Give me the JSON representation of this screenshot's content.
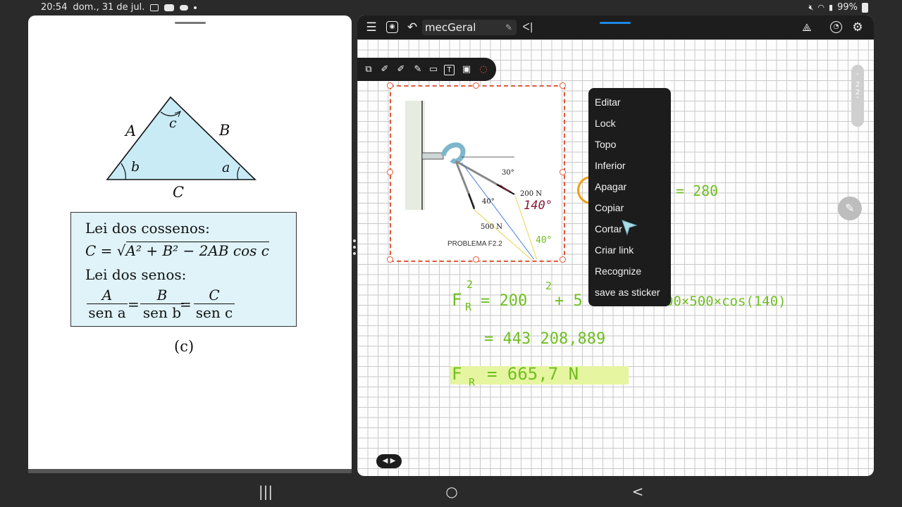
{
  "status_bar": {
    "time": "20:54",
    "date": "dom., 31 de jul.",
    "battery": "99%",
    "icons_left": [
      "screen-record-icon",
      "youtube-icon",
      "cloud-icon",
      "dot-icon"
    ],
    "icons_right": [
      "mute-icon",
      "wifi-icon",
      "signal-icon",
      "battery-icon"
    ]
  },
  "left_pane": {
    "triangle": {
      "side_A": "A",
      "side_B": "B",
      "side_C": "C",
      "angle_a": "a",
      "angle_b": "b",
      "angle_c": "c",
      "fill": "#c8ebf6"
    },
    "formulas": {
      "cosine_title": "Lei dos cossenos:",
      "cosine_lhs": "C =",
      "cosine_rhs": "A² + B² − 2AB cos c",
      "sine_title": "Lei dos senos:",
      "sine_terms": [
        {
          "num": "A",
          "den": "sen a"
        },
        {
          "num": "B",
          "den": "sen b"
        },
        {
          "num": "C",
          "den": "sen c"
        }
      ],
      "equals": "="
    },
    "caption": "(c)"
  },
  "right_pane": {
    "toolbar": {
      "title": "mecGeral",
      "icons": [
        "menu-icon",
        "view-icon",
        "undo-icon",
        "edit-title-icon",
        "collapse-icon",
        "ai-icon",
        "history-icon",
        "settings-icon"
      ]
    },
    "pen_tools": [
      "select-icon",
      "pen-icon",
      "pen-icon",
      "highlighter-icon",
      "eraser-icon",
      "text-icon",
      "image-icon",
      "lasso-icon"
    ],
    "page_indicator": {
      "current": "2",
      "total": "2"
    },
    "figure": {
      "label_30": "30°",
      "label_40": "40°",
      "label_200": "200 N",
      "label_500": "500 N",
      "label_problem": "PROBLEMA F2.2"
    },
    "ink": {
      "angle_140": "140°",
      "angle_40": "40°",
      "eq_280": "= 280",
      "line1_lhs": "F",
      "line1_sub": "R",
      "line1_sup": "2",
      "line1_rhs": "= 200",
      "line1_sup2": "2",
      "line1_rest": "+ 5",
      "line1_tail": "00×500×cos(140)",
      "line2": "= 443 208,889",
      "line3_lhs": "F",
      "line3_sub": "R",
      "line3_rhs": "= 665,7 N",
      "ink_color": "#6fbf1f",
      "highlight_color": "#e6f5a0"
    },
    "context_menu": {
      "items": [
        "Editar",
        "Lock",
        "Topo",
        "Inferior",
        "Apagar",
        "Copiar",
        "Cortar",
        "Criar link",
        "Recognize",
        "save as sticker"
      ]
    },
    "selection_color": "#e05a3a"
  },
  "nav_bar": {
    "recent": "|||",
    "home": "○",
    "back": "<"
  }
}
